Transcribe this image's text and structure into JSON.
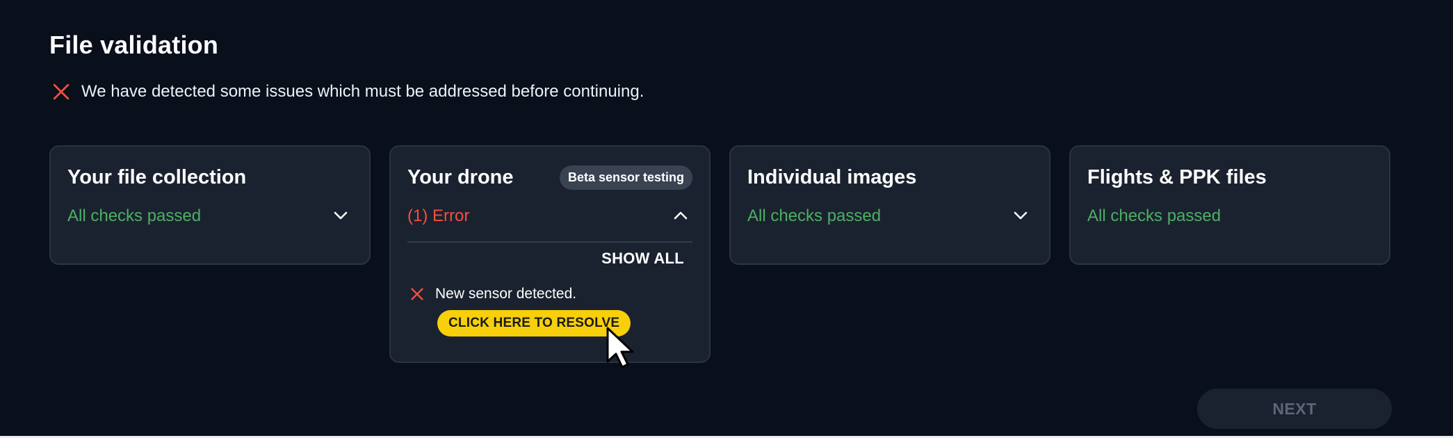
{
  "page": {
    "title": "File validation",
    "issue_message": "We have detected some issues which must be addressed before continuing."
  },
  "cards": [
    {
      "title": "Your file collection",
      "status": "All checks passed",
      "expanded": false
    },
    {
      "title": "Your drone",
      "badge": "Beta sensor testing",
      "status": "(1) Error",
      "expanded": true,
      "show_all_label": "SHOW ALL",
      "issues": [
        {
          "text": "New sensor detected.",
          "action_label": "CLICK HERE TO RESOLVE"
        }
      ]
    },
    {
      "title": "Individual images",
      "status": "All checks passed",
      "expanded": false
    },
    {
      "title": "Flights & PPK files",
      "status": "All checks passed",
      "expanded": false
    }
  ],
  "footer": {
    "next_label": "NEXT"
  },
  "colors": {
    "background": "#0a0f1c",
    "card": "#1b222f",
    "success": "#4caf64",
    "error": "#f05040",
    "accent": "#f7cf0a"
  },
  "icons": {
    "error": "close-icon",
    "collapse": "chevron-up-icon",
    "expand": "chevron-down-icon",
    "pointer": "mouse-pointer-icon"
  }
}
